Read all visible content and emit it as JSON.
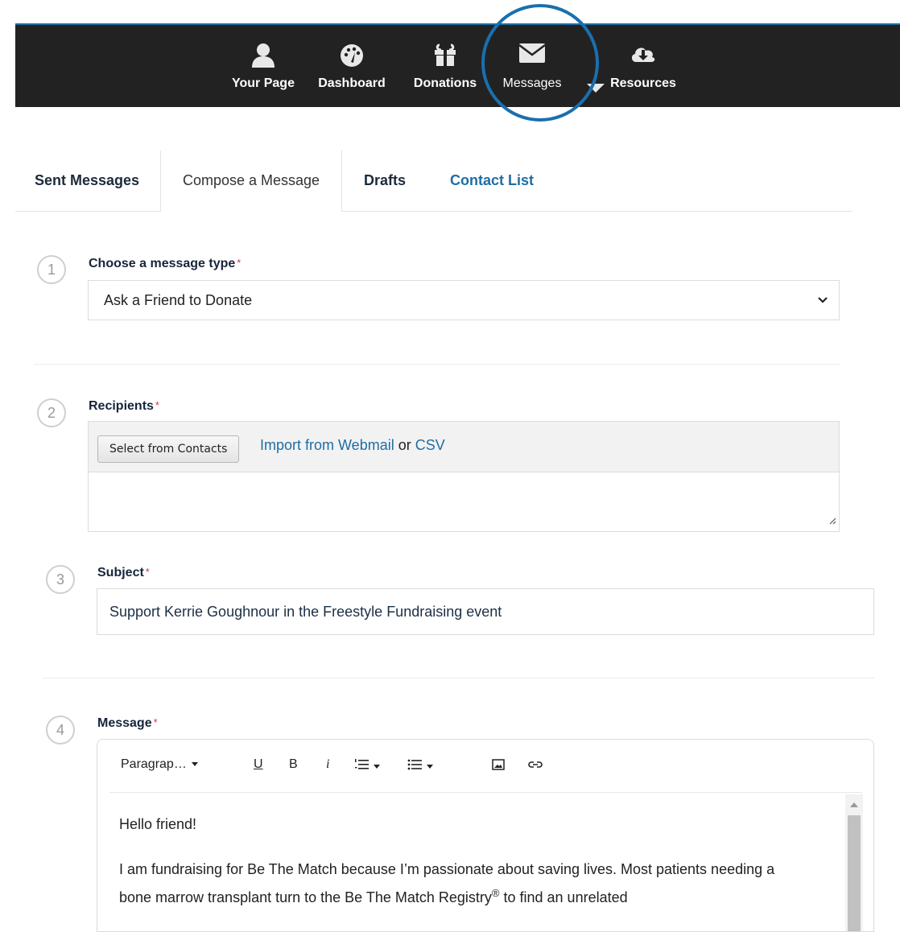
{
  "nav": {
    "items": [
      {
        "label": "Your Page",
        "icon": "user-icon"
      },
      {
        "label": "Dashboard",
        "icon": "dashboard-icon"
      },
      {
        "label": "Donations",
        "icon": "gift-icon"
      },
      {
        "label": "Messages",
        "icon": "envelope-icon"
      },
      {
        "label": "Resources",
        "icon": "cloud-download-icon"
      }
    ]
  },
  "tabs": [
    {
      "label": "Sent Messages"
    },
    {
      "label": "Compose a Message"
    },
    {
      "label": "Drafts"
    },
    {
      "label": "Contact List"
    }
  ],
  "form": {
    "required_mark": "*",
    "step1": {
      "number": "1",
      "label": "Choose a message type",
      "value": "Ask a Friend to Donate"
    },
    "step2": {
      "number": "2",
      "label": "Recipients",
      "select_button": "Select from Contacts",
      "import_link": "Import from Webmail",
      "or_text": "or",
      "csv_link": "CSV"
    },
    "step3": {
      "number": "3",
      "label": "Subject",
      "value": "Support Kerrie Goughnour in the Freestyle Fundraising event"
    },
    "step4": {
      "number": "4",
      "label": "Message",
      "toolbar": {
        "paragraph": "Paragrap…",
        "underline": "U",
        "bold": "B",
        "italic": "i"
      },
      "body": {
        "greeting": "Hello friend!",
        "paragraph1_part1": "I am fundraising for Be The Match because I’m passionate about saving lives. Most patients needing a bone marrow transplant turn to the Be The Match Registry",
        "registered_mark": "®",
        "paragraph1_part2": " to find an unrelated"
      }
    }
  },
  "colors": {
    "nav_bg": "#222222",
    "link": "#1e6ea3",
    "highlight_ring": "#1a6fae",
    "required": "#d23b3b"
  }
}
